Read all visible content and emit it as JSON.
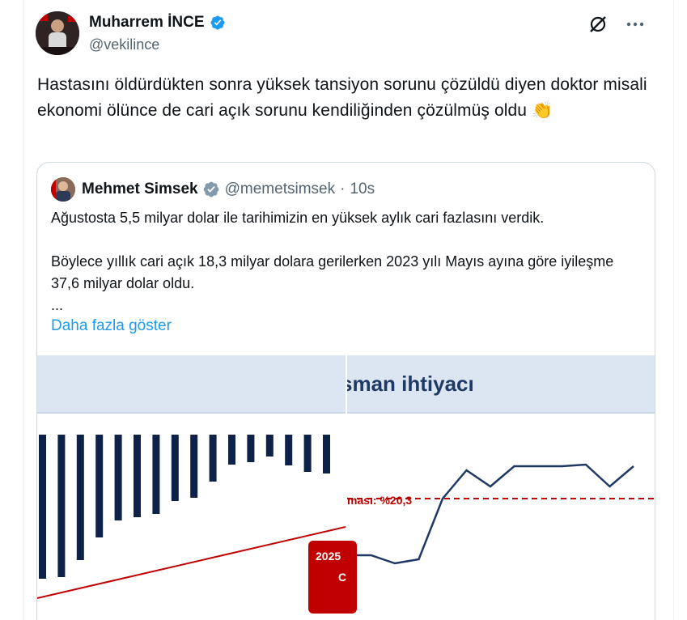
{
  "tweet": {
    "author_name": "Muharrem İNCE",
    "author_handle": "@vekilince",
    "text": "Hastasını öldürdükten sonra yüksek tansiyon sorunu çözüldü diyen doktor misali ekonomi ölünce de cari açık sorunu kendiliğinden çözülmüş oldu 👏"
  },
  "quote": {
    "author_name": "Mehmet Simsek",
    "author_handle": "@memetsimsek",
    "separator": "·",
    "time": "10s",
    "paragraph1": "Ağustosta 5,5 milyar dolar ile tarihimizin en yüksek aylık cari fazlasını verdik.",
    "paragraph2": "Böylece yıllık cari açık 18,3 milyar dolara gerilerken 2023 yılı Mayıs ayına göre iyileşme 37,6 milyar dolar oldu.",
    "ellipsis": "...",
    "show_more": "Daha fazla göster"
  },
  "media": {
    "right_title": "sman ihtiyacı",
    "ref_label": "ması: %20,3",
    "red_box_line1": "2025",
    "red_box_line2": "C"
  },
  "colors": {
    "verified_blue": "#1d9bf0",
    "verified_gray": "#829aab",
    "link_blue": "#1d9bf0",
    "bar_navy": "#0d2149",
    "trend_red": "#c00000"
  },
  "icons": {
    "header": [
      "grok-icon",
      "more-icon"
    ]
  },
  "chart_data": [
    {
      "type": "bar",
      "title": "",
      "series": [
        {
          "values": [
            -178,
            -176,
            -155,
            -127,
            -106,
            -102,
            -98,
            -82,
            -78,
            -58,
            -37,
            -34,
            -27,
            -38,
            -46,
            -48
          ]
        }
      ],
      "trend": "rising red line, left to right"
    },
    {
      "type": "line",
      "title": "sman ihtiyacı",
      "series": [
        {
          "values": [
            40,
            40,
            30,
            35,
            110,
            145,
            125,
            150,
            150,
            150,
            152,
            125,
            150
          ]
        }
      ],
      "reference_label": "ması: %20,3",
      "reference_value": 110
    }
  ]
}
